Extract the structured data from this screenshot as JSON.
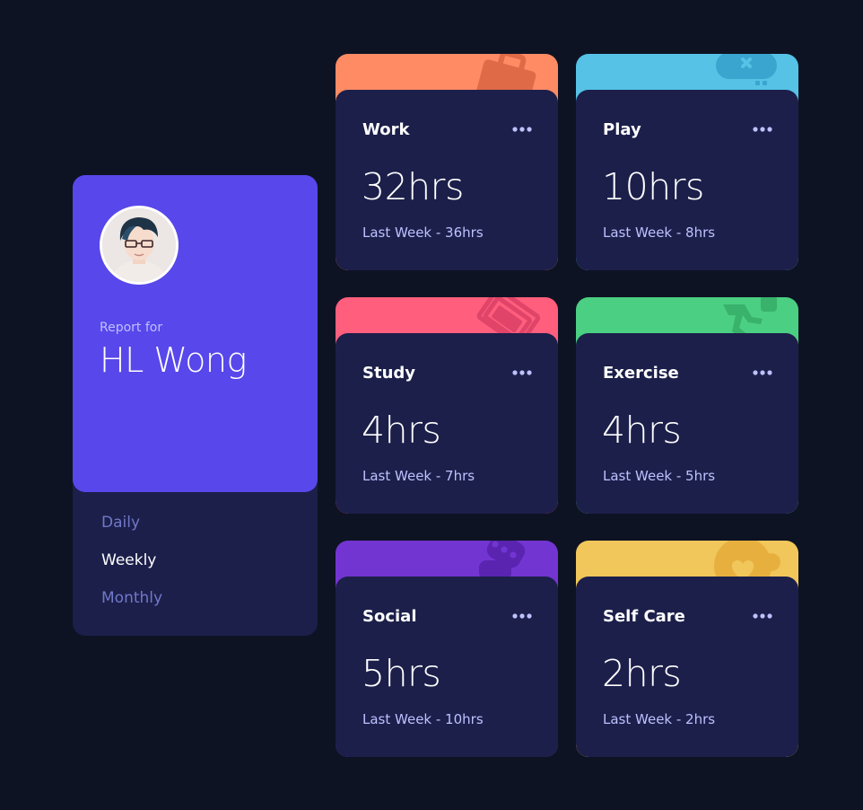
{
  "colors": {
    "background": "#0e1323",
    "card": "#1c1f4a",
    "profile_accent": "#5847eb",
    "work": "#ff8b64",
    "play": "#55c2e6",
    "study": "#ff5e7d",
    "exercise": "#4bcf82",
    "social": "#7335d2",
    "self_care": "#f1c75b"
  },
  "profile": {
    "report_for": "Report for",
    "name": "HL Wong",
    "periods": [
      "Daily",
      "Weekly",
      "Monthly"
    ],
    "active_period": "Weekly"
  },
  "activities": [
    {
      "title": "Work",
      "current": "32hrs",
      "previous": "Last Week - 36hrs",
      "color": "#ff8b64",
      "icon": "briefcase-icon"
    },
    {
      "title": "Play",
      "current": "10hrs",
      "previous": "Last Week - 8hrs",
      "color": "#55c2e6",
      "icon": "gamepad-icon"
    },
    {
      "title": "Study",
      "current": "4hrs",
      "previous": "Last Week - 7hrs",
      "color": "#ff5e7d",
      "icon": "book-icon"
    },
    {
      "title": "Exercise",
      "current": "4hrs",
      "previous": "Last Week - 5hrs",
      "color": "#4bcf82",
      "icon": "running-icon"
    },
    {
      "title": "Social",
      "current": "5hrs",
      "previous": "Last Week - 10hrs",
      "color": "#7335d2",
      "icon": "chat-icon"
    },
    {
      "title": "Self Care",
      "current": "2hrs",
      "previous": "Last Week - 2hrs",
      "color": "#f1c75b",
      "icon": "heart-icon"
    }
  ]
}
